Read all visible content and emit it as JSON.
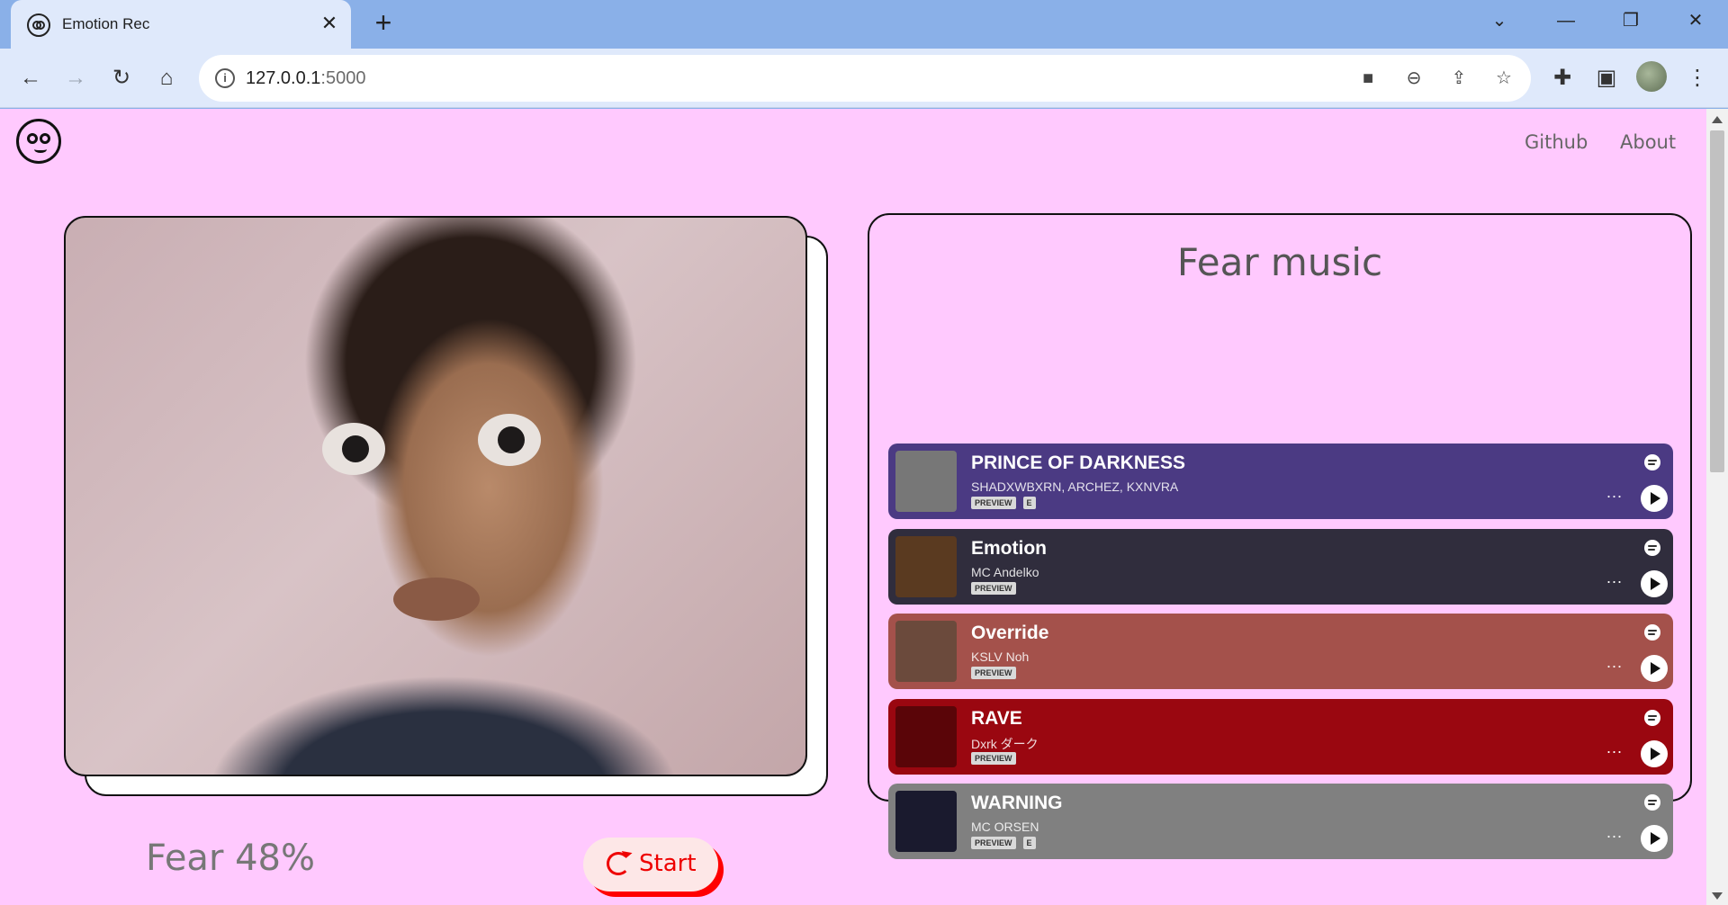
{
  "browser": {
    "tab_title": "Emotion Rec",
    "tab_close": "✕",
    "new_tab": "+",
    "url_host": "127.0.0.1",
    "url_port": ":5000",
    "icons": [
      "back-icon",
      "forward-icon",
      "reload-icon",
      "home-icon",
      "site-info-icon",
      "camera-icon",
      "zoom-out-icon",
      "share-icon",
      "bookmark-star-icon",
      "extensions-icon",
      "side-panel-icon",
      "profile-avatar",
      "menu-icon"
    ],
    "window_controls": [
      "⌄",
      "—",
      "❐",
      "✕"
    ]
  },
  "page": {
    "background": "#ffc9fe",
    "nav": {
      "github": "Github",
      "about": "About"
    },
    "emotion_result": "Fear 48%",
    "start_button": "Start",
    "music_title": "Fear music",
    "tracks": [
      {
        "title": "PRINCE OF DARKNESS",
        "artist": "SHADXWBXRN, ARCHEZ, KXNVRA",
        "preview": "PREVIEW",
        "explicit": "E",
        "color": "#4b3a83",
        "cover_color": "#777777"
      },
      {
        "title": "Emotion",
        "artist": "MC Andelko",
        "preview": "PREVIEW",
        "explicit": "",
        "color": "#302d3d",
        "cover_color": "#5a3a20"
      },
      {
        "title": "Override",
        "artist": "KSLV Noh",
        "preview": "PREVIEW",
        "explicit": "",
        "color": "#a4514b",
        "cover_color": "#6b4a3c"
      },
      {
        "title": "RAVE",
        "artist": "Dxrk ダーク",
        "preview": "PREVIEW",
        "explicit": "",
        "color": "#9a0710",
        "cover_color": "#5a0508"
      },
      {
        "title": "WARNING",
        "artist": "MC ORSEN",
        "preview": "PREVIEW",
        "explicit": "E",
        "color": "#808080",
        "cover_color": "#1a1a2e"
      }
    ],
    "more_label": "...",
    "accent": "#ff0000"
  }
}
